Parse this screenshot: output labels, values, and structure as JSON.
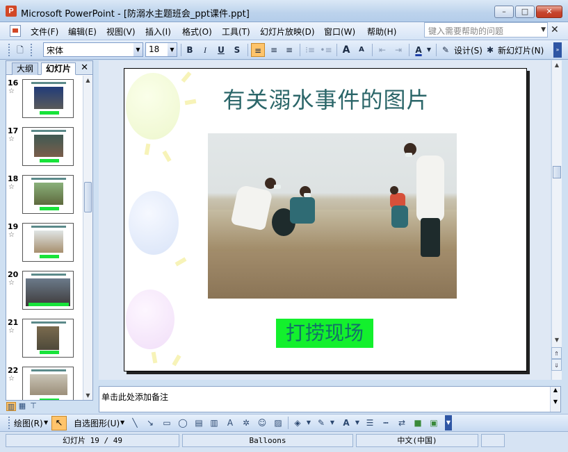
{
  "window": {
    "title": "Microsoft PowerPoint - [防溺水主题班会_ppt课件.ppt]",
    "controls": {
      "minimize": "–",
      "maximize": "□",
      "close": "✕"
    }
  },
  "menu": {
    "items": [
      "文件(F)",
      "编辑(E)",
      "视图(V)",
      "插入(I)",
      "格式(O)",
      "工具(T)",
      "幻灯片放映(D)",
      "窗口(W)",
      "帮助(H)"
    ],
    "help_placeholder": "键入需要帮助的问题",
    "close": "✕"
  },
  "toolbar": {
    "font_name": "宋体",
    "font_size": "18",
    "bold": "B",
    "italic": "I",
    "underline": "U",
    "shadow": "S",
    "align_left": "≡",
    "align_center": "≡",
    "align_right": "≡",
    "numbered_list": "⁝≡",
    "bullet_list": "•≡",
    "grow_font": "A",
    "shrink_font": "A",
    "decrease_indent": "⇤",
    "increase_indent": "⇥",
    "font_color": "A",
    "design_label": "设计(S)",
    "new_slide_label": "新幻灯片(N)"
  },
  "left_pane": {
    "tabs": [
      "大纲",
      "幻灯片"
    ],
    "close": "✕",
    "slides": [
      "16",
      "17",
      "18",
      "19",
      "20",
      "21",
      "22"
    ],
    "star": "☆"
  },
  "slide": {
    "title": "有关溺水事件的图片",
    "caption": "打捞现场"
  },
  "notes": {
    "placeholder": "单击此处添加备注"
  },
  "drawing_toolbar": {
    "draw_label": "绘图(R)",
    "autoshapes_label": "自选图形(U)"
  },
  "status": {
    "slide_position": "幻灯片 19 / 49",
    "design_template": "Balloons",
    "language": "中文(中国)"
  },
  "colors": {
    "title_text": "#2b6669",
    "caption_bg": "#13f02d",
    "caption_text": "#137068"
  }
}
